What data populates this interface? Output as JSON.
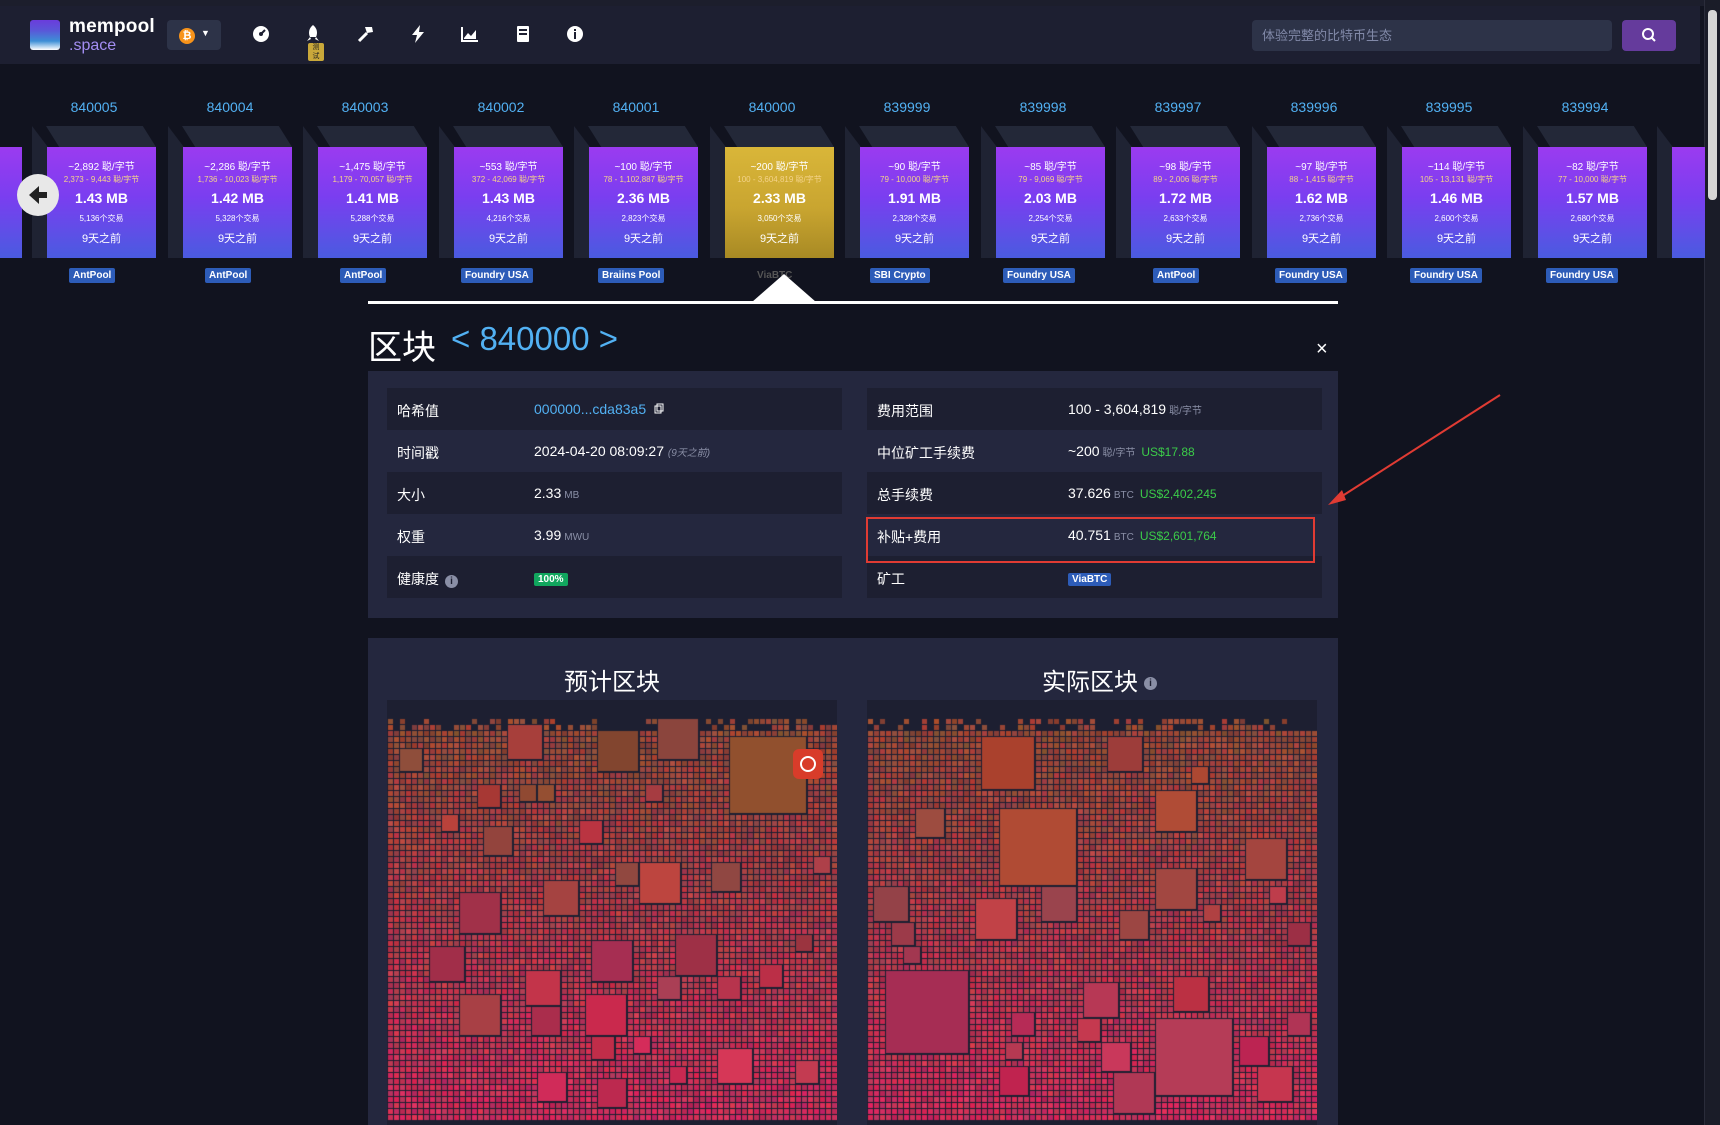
{
  "navbar": {
    "logo_line1": "mempool",
    "logo_line2": ".space",
    "network_symbol": "₿",
    "nav_icons": [
      "dashboard-gauge-icon",
      "rocket-icon",
      "hammer-icon",
      "lightning-icon",
      "chart-icon",
      "docs-icon",
      "info-icon"
    ],
    "rocket_badge": "测试",
    "search_placeholder": "体验完整的比特币生态"
  },
  "carousel": {
    "blocks": [
      {
        "height": "840005",
        "fee": "~2,892 聪/字节",
        "range": "2,373 - 9,443 聪/字节",
        "size": "1.43 MB",
        "txs": "5,136个交易",
        "time": "9天之前",
        "pool": "AntPool"
      },
      {
        "height": "840004",
        "fee": "~2,286 聪/字节",
        "range": "1,736 - 10,023 聪/字节",
        "size": "1.42 MB",
        "txs": "5,328个交易",
        "time": "9天之前",
        "pool": "AntPool"
      },
      {
        "height": "840003",
        "fee": "~1,475 聪/字节",
        "range": "1,179 - 70,057 聪/字节",
        "size": "1.41 MB",
        "txs": "5,288个交易",
        "time": "9天之前",
        "pool": "AntPool"
      },
      {
        "height": "840002",
        "fee": "~553 聪/字节",
        "range": "372 - 42,069 聪/字节",
        "size": "1.43 MB",
        "txs": "4,216个交易",
        "time": "9天之前",
        "pool": "Foundry USA"
      },
      {
        "height": "840001",
        "fee": "~100 聪/字节",
        "range": "78 - 1,102,887 聪/字节",
        "size": "2.36 MB",
        "txs": "2,823个交易",
        "time": "9天之前",
        "pool": "Braiins Pool"
      },
      {
        "height": "840000",
        "fee": "~200 聪/字节",
        "range": "100 - 3,604,819 聪/字节",
        "size": "2.33 MB",
        "txs": "3,050个交易",
        "time": "9天之前",
        "pool": "ViaBTC",
        "current": true
      },
      {
        "height": "839999",
        "fee": "~90 聪/字节",
        "range": "79 - 10,000 聪/字节",
        "size": "1.91 MB",
        "txs": "2,328个交易",
        "time": "9天之前",
        "pool": "SBI Crypto"
      },
      {
        "height": "839998",
        "fee": "~85 聪/字节",
        "range": "79 - 9,069 聪/字节",
        "size": "2.03 MB",
        "txs": "2,254个交易",
        "time": "9天之前",
        "pool": "Foundry USA"
      },
      {
        "height": "839997",
        "fee": "~98 聪/字节",
        "range": "89 - 2,006 聪/字节",
        "size": "1.72 MB",
        "txs": "2,633个交易",
        "time": "9天之前",
        "pool": "AntPool"
      },
      {
        "height": "839996",
        "fee": "~97 聪/字节",
        "range": "88 - 1,415 聪/字节",
        "size": "1.62 MB",
        "txs": "2,736个交易",
        "time": "9天之前",
        "pool": "Foundry USA"
      },
      {
        "height": "839995",
        "fee": "~114 聪/字节",
        "range": "105 - 13,131 聪/字节",
        "size": "1.46 MB",
        "txs": "2,600个交易",
        "time": "9天之前",
        "pool": "Foundry USA"
      },
      {
        "height": "839994",
        "fee": "~82 聪/字节",
        "range": "77 - 10,000 聪/字节",
        "size": "1.57 MB",
        "txs": "2,680个交易",
        "time": "9天之前",
        "pool": "Foundry USA"
      }
    ]
  },
  "block": {
    "title": "区块",
    "height": "840000",
    "prev_symbol": "<",
    "next_symbol": ">",
    "close_symbol": "×"
  },
  "details": {
    "hash_label": "哈希值",
    "hash_value": "000000...cda83a5",
    "timestamp_label": "时间戳",
    "timestamp_value": "2024-04-20 08:09:27",
    "timestamp_ago": "(9天之前)",
    "size_label": "大小",
    "size_value": "2.33",
    "size_unit": "MB",
    "weight_label": "权重",
    "weight_value": "3.99",
    "weight_unit": "MWU",
    "health_label": "健康度",
    "health_value": "100%",
    "fee_span_label": "费用范围",
    "fee_span_value": "100 - 3,604,819",
    "fee_span_unit": "聪/字节",
    "median_fee_label": "中位矿工手续费",
    "median_fee_value": "~200",
    "median_fee_unit": "聪/字节",
    "median_fee_usd": "US$17.88",
    "total_fees_label": "总手续费",
    "total_fees_value": "37.626",
    "total_fees_unit": "BTC",
    "total_fees_usd": "US$2,402,245",
    "subsidy_label": "补贴+费用",
    "subsidy_value": "40.751",
    "subsidy_unit": "BTC",
    "subsidy_usd": "US$2,601,764",
    "miner_label": "矿工",
    "miner_value": "ViaBTC"
  },
  "treemaps": {
    "expected_title": "预计区块",
    "actual_title": "实际区块"
  },
  "colors": {
    "accent_blue": "#52b1f3",
    "usd_green": "#3bcc49",
    "block_purple": "#7a3ef0",
    "block_gold": "#c9a530",
    "highlight_red": "#e03b33"
  }
}
